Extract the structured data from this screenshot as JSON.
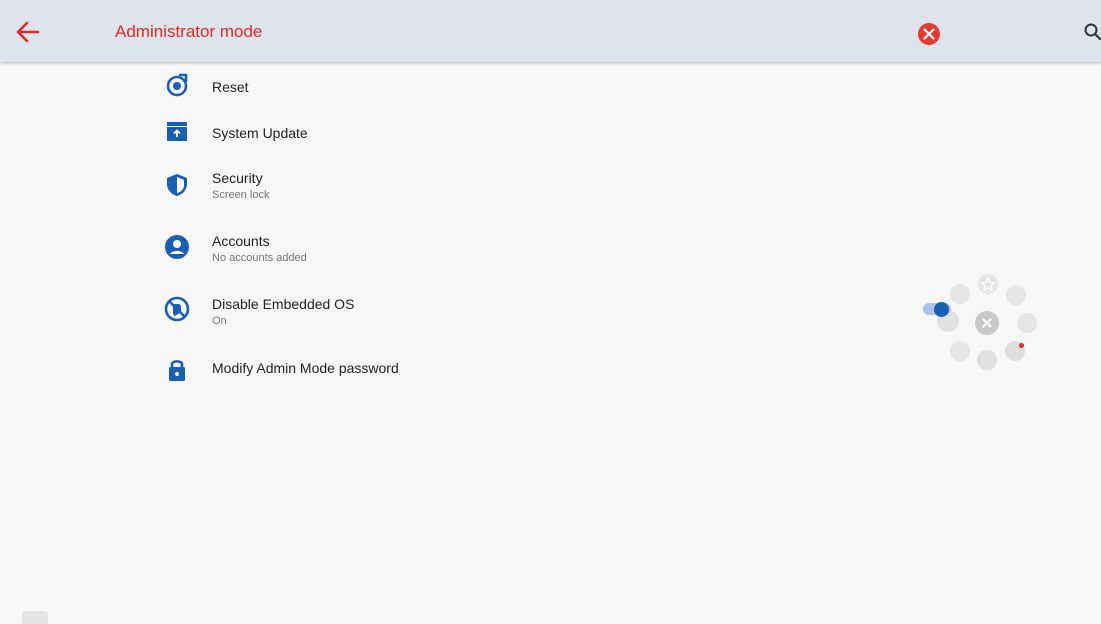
{
  "appbar": {
    "title": "Administrator mode",
    "back_icon": "arrow-left-icon",
    "close_icon": "close-circle-icon",
    "search_icon": "search-icon"
  },
  "colors": {
    "accent": "#e02a2a",
    "icon_blue": "#1a5fb4",
    "appbar_bg": "#dfe3ec",
    "page_bg": "#f7f7f7"
  },
  "settings": [
    {
      "label": "Reset",
      "subtitle": "",
      "icon": "reset-icon"
    },
    {
      "label": "System Update",
      "subtitle": "",
      "icon": "system-update-icon"
    },
    {
      "label": "Security",
      "subtitle": "Screen lock",
      "icon": "shield-icon"
    },
    {
      "label": "Accounts",
      "subtitle": "No accounts added",
      "icon": "account-icon"
    },
    {
      "label": "Disable Embedded OS",
      "subtitle": "On",
      "icon": "disable-os-icon"
    },
    {
      "label": "Modify Admin Mode password",
      "subtitle": "",
      "icon": "lock-icon"
    }
  ],
  "floating_menu": {
    "icons": [
      "star-icon",
      "exit-icon",
      "home-icon",
      "note-icon",
      "screen-icon",
      "window-icon",
      "return-icon",
      "split-icon",
      "close-icon"
    ]
  }
}
